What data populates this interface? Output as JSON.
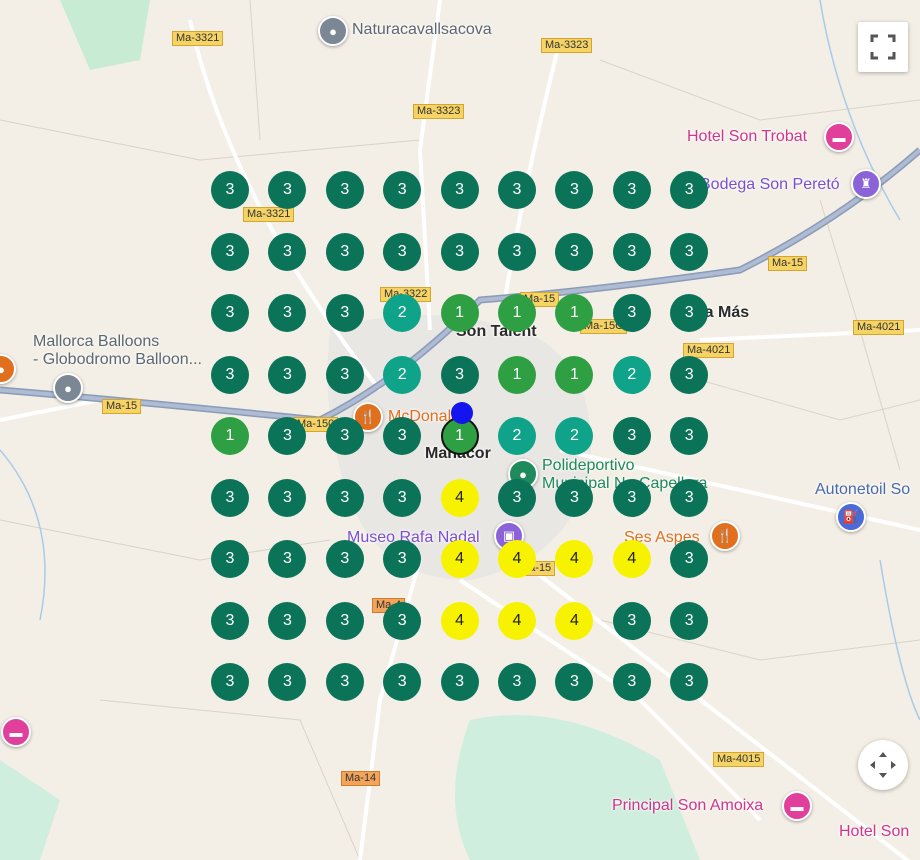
{
  "roads": [
    "Ma-3321",
    "Ma-3323",
    "Ma-3323",
    "Ma-3321",
    "Ma-3322",
    "Ma-15",
    "Ma-15",
    "Ma-15C",
    "Ma-4021",
    "Ma-4021",
    "Ma-15",
    "Ma-150",
    "Ma-15",
    "Ma-4015",
    "Ma-14",
    "Ma-4015",
    "Ma-4"
  ],
  "places": {
    "naturacavallsacova": "Naturacavallsacova",
    "hotel_son_trobat": "Hotel Son Trobat",
    "bodega": "Bodega Son Peretó",
    "mallorca_balloons_1": "Mallorca Balloons",
    "mallorca_balloons_2": "- Globodromo Balloon...",
    "son_talent": "Son Talent",
    "sa_mas": "Sa Más",
    "mcdonalds": "McDonald's",
    "manacor": "Manacor",
    "polideportivo_1": "Polideportivo",
    "polideportivo_2": "Municipal Na Capellera",
    "autonetoil": "Autonetoil So",
    "museo_rafa_nadal": "Museo Rafa Nadal",
    "ses_aspes": "Ses Aspes",
    "principal_son_amoixa": "Principal Son Amoixa",
    "hotel_son": "Hotel Son"
  },
  "grid": [
    [
      3,
      3,
      3,
      3,
      3,
      3,
      3,
      3,
      3
    ],
    [
      3,
      3,
      3,
      3,
      3,
      3,
      3,
      3,
      3
    ],
    [
      3,
      3,
      3,
      2,
      1,
      1,
      1,
      3,
      3
    ],
    [
      3,
      3,
      3,
      2,
      3,
      1,
      1,
      2,
      3
    ],
    [
      1,
      3,
      3,
      3,
      1,
      2,
      2,
      3,
      3
    ],
    [
      3,
      3,
      3,
      3,
      4,
      3,
      3,
      3,
      3
    ],
    [
      3,
      3,
      3,
      3,
      4,
      4,
      4,
      4,
      3
    ],
    [
      3,
      3,
      3,
      3,
      4,
      4,
      4,
      3,
      3
    ],
    [
      3,
      3,
      3,
      3,
      3,
      3,
      3,
      3,
      3
    ]
  ],
  "highlighted_cell": {
    "row": 4,
    "col": 4
  },
  "rank_colors": {
    "1": "#2ea043",
    "2": "#0fa38a",
    "3": "#0a7358",
    "4": "#f7f300"
  },
  "controls": {
    "fullscreen_icon": "fullscreen-icon",
    "recenter_icon": "recenter-icon"
  }
}
